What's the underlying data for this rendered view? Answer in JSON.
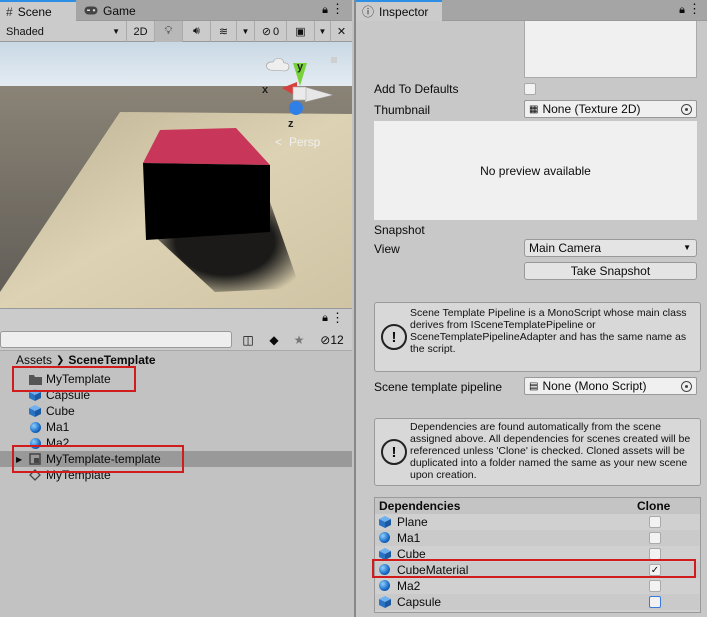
{
  "scene_tabs": [
    {
      "label": "Scene",
      "icon": "grid-icon"
    },
    {
      "label": "Game",
      "icon": "gamepad-icon"
    }
  ],
  "scene_toolbar": {
    "shading": "Shaded",
    "mode_2d": "2D",
    "gizmo_count": "0"
  },
  "scene_view": {
    "axis_x": "x",
    "axis_y": "y",
    "axis_z": "z",
    "persp_label": "Persp",
    "cube_top_color": "#c8365a",
    "sky_color": "#d8e4ee",
    "floor_color": "#d3c8a8"
  },
  "project": {
    "hidden_count": "12",
    "breadcrumb": {
      "root": "Assets",
      "current": "SceneTemplate"
    },
    "items": [
      {
        "label": "MyTemplate",
        "icon": "folder-icon"
      },
      {
        "label": "Capsule",
        "icon": "cube-icon"
      },
      {
        "label": "Cube",
        "icon": "cube-icon"
      },
      {
        "label": "Ma1",
        "icon": "material-icon"
      },
      {
        "label": "Ma2",
        "icon": "material-icon"
      },
      {
        "label": "MyTemplate-template",
        "icon": "scene-template-icon"
      },
      {
        "label": "MyTemplate",
        "icon": "scene-icon"
      }
    ]
  },
  "inspector": {
    "tab_label": "Inspector",
    "add_to_defaults_label": "Add To Defaults",
    "thumbnail_label": "Thumbnail",
    "thumbnail_value": "None (Texture 2D)",
    "no_preview": "No preview available",
    "snapshot_label": "Snapshot",
    "view_label": "View",
    "view_value": "Main Camera",
    "take_snapshot": "Take Snapshot",
    "pipeline_help": "Scene Template Pipeline is a MonoScript whose main class derives from ISceneTemplatePipeline or SceneTemplatePipelineAdapter and has the same name as the script.",
    "pipeline_label": "Scene template pipeline",
    "pipeline_value": "None (Mono Script)",
    "deps_help": "Dependencies are found automatically from the scene assigned above. All dependencies for scenes created will be referenced unless 'Clone' is checked. Cloned assets will be duplicated into a folder named the same as your new scene upon creation.",
    "deps_header": "Dependencies",
    "clone_header": "Clone",
    "dependencies": [
      {
        "name": "Plane",
        "icon": "cube-icon",
        "clone": false
      },
      {
        "name": "Ma1",
        "icon": "material-icon",
        "clone": false
      },
      {
        "name": "Cube",
        "icon": "cube-icon",
        "clone": false
      },
      {
        "name": "CubeMaterial",
        "icon": "material-icon",
        "clone": true
      },
      {
        "name": "Ma2",
        "icon": "material-icon",
        "clone": false
      },
      {
        "name": "Capsule",
        "icon": "cube-icon",
        "clone": false
      }
    ],
    "check_mark": "✓"
  }
}
